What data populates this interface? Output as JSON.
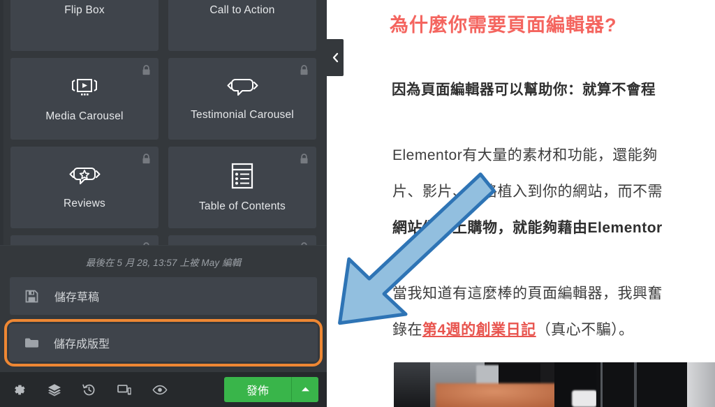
{
  "panel": {
    "widgets": [
      {
        "label": "Flip Box",
        "icon": "none",
        "locked": false
      },
      {
        "label": "Call to Action",
        "icon": "none",
        "locked": false
      },
      {
        "label": "Media Carousel",
        "icon": "media-carousel-icon",
        "locked": true
      },
      {
        "label": "Testimonial Carousel",
        "icon": "testimonial-carousel-icon",
        "locked": true
      },
      {
        "label": "Reviews",
        "icon": "reviews-icon",
        "locked": true
      },
      {
        "label": "Table of Contents",
        "icon": "table-of-contents-icon",
        "locked": true
      },
      {
        "label": "",
        "icon": "partial-icon",
        "locked": true
      },
      {
        "label": "",
        "icon": "partial-icon",
        "locked": true
      }
    ],
    "collapse_tab_icon": "chevron-left-icon"
  },
  "footer": {
    "last_edited": "最後在 5 月 28, 13:57 上被 May 編輯",
    "save_draft": {
      "label": "儲存草稿",
      "icon": "floppy-disk-icon"
    },
    "save_template": {
      "label": "儲存成版型",
      "icon": "folder-icon"
    },
    "highlight_color": "#ee8733"
  },
  "toolbar": {
    "icons": [
      {
        "name": "settings-gear-icon",
        "title": "設定"
      },
      {
        "name": "navigator-layers-icon",
        "title": "導覽器"
      },
      {
        "name": "history-revisions-icon",
        "title": "歷史紀錄"
      },
      {
        "name": "responsive-mode-icon",
        "title": "回應模式"
      },
      {
        "name": "preview-eye-icon",
        "title": "預覽變更"
      }
    ],
    "publish_label": "發佈",
    "publish_color": "#39b54a",
    "publish_dropdown_icon": "chevron-up-icon"
  },
  "content": {
    "title": "為什麼你需要頁面編輯器?",
    "title_color": "#f4655f",
    "lead": "因為頁面編輯器可以幫助你：就算不會程",
    "body_lines": [
      {
        "text": "Elementor有大量的素材和功能，還能夠",
        "bold": false
      },
      {
        "text": "片、影片、表格植入到你的網站，而不需",
        "bold": false
      },
      {
        "text": "網站做線上購物，就能夠藉由Elementor",
        "bold": true
      }
    ],
    "tail_lines": [
      {
        "text": "當我知道有這麼棒的頁面編輯器，我興奮",
        "bold": false
      }
    ],
    "tail_prefix": "錄在",
    "tail_link": "第4週的創業日記",
    "tail_suffix": "（真心不騙）。",
    "link_color": "#e8544e"
  },
  "annotation": {
    "arrow_fill": "#92bfdf",
    "arrow_stroke": "#2e74b5",
    "points_to": "儲存成版型"
  }
}
